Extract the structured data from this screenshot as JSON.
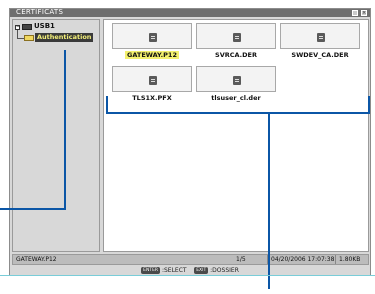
{
  "window": {
    "title": "CERTIFICATS"
  },
  "tree": {
    "drive_label": "USB1",
    "folder_label": "Authentication"
  },
  "files": [
    {
      "name": "GATEWAY.P12",
      "selected": true
    },
    {
      "name": "SVRCA.DER",
      "selected": false
    },
    {
      "name": "SWDEV_CA.DER",
      "selected": false
    },
    {
      "name": "TLS1X.PFX",
      "selected": false
    },
    {
      "name": "tlsuser_cl.der",
      "selected": false
    }
  ],
  "status": {
    "filename": "GATEWAY.P12",
    "page": "1/5",
    "datetime": "04/20/2006 17:07:38",
    "size": "1.80KB"
  },
  "hint": {
    "enter_key": "ENTER",
    "select_label": ":SELECT",
    "exit_key": "EXIT",
    "dossier_label": ":DOSSIER"
  },
  "colors": {
    "callout": "#0b56a6",
    "highlight": "#f3f06e"
  }
}
